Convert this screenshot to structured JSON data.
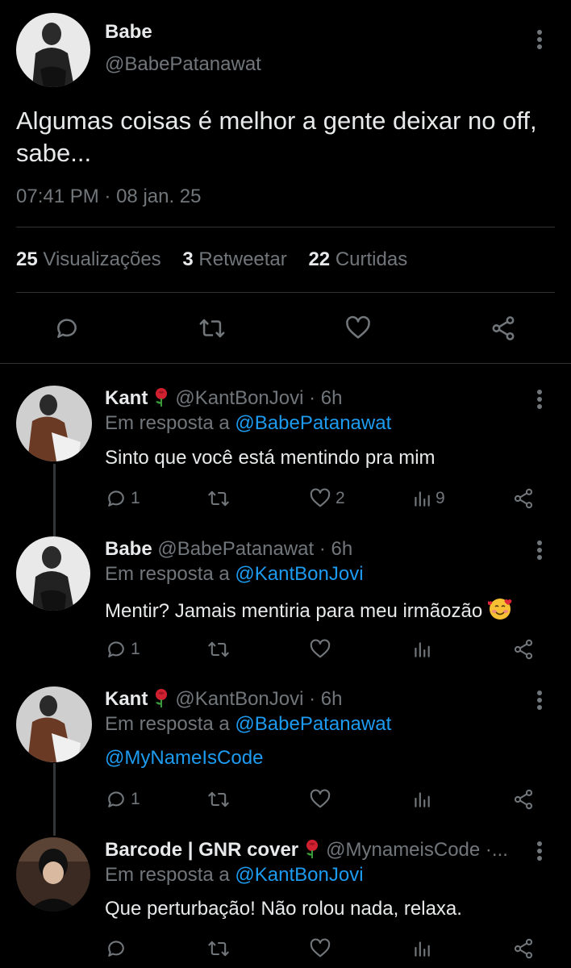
{
  "main_tweet": {
    "author_name": "Babe",
    "author_handle": "@BabePatanawat",
    "text": "Algumas coisas é melhor a gente deixar no off, sabe...",
    "time": "07:41 PM",
    "separator": "·",
    "date": "08 jan. 25",
    "stats": {
      "views_count": "25",
      "views_label": "Visualizações",
      "retweets_count": "3",
      "retweets_label": "Retweetar",
      "likes_count": "22",
      "likes_label": "Curtidas"
    },
    "actions": [
      "reply-icon",
      "retweet-icon",
      "like-icon",
      "share-icon"
    ]
  },
  "replies": [
    {
      "name": "Kant",
      "badge": "rose-emoji",
      "handle": "@KantBonJovi",
      "time": "· 6h",
      "reply_prefix": "Em resposta a",
      "reply_to": "@BabePatanawat",
      "text": "Sinto que você está mentindo pra mim",
      "reply_count": "1",
      "retweet_count": "",
      "like_count": "2",
      "view_count": "9"
    },
    {
      "name": "Babe",
      "badge": "",
      "handle": "@BabePatanawat",
      "time": "· 6h",
      "reply_prefix": "Em resposta a",
      "reply_to": "@KantBonJovi",
      "text": "Mentir? Jamais mentiria para meu irmãozão",
      "text_emoji": "smiling-face-with-hearts-emoji",
      "reply_count": "1",
      "retweet_count": "",
      "like_count": "",
      "view_count": ""
    },
    {
      "name": "Kant",
      "badge": "rose-emoji",
      "handle": "@KantBonJovi",
      "time": "· 6h",
      "reply_prefix": "Em resposta a",
      "reply_to": "@BabePatanawat",
      "text": "@MyNameIsCode",
      "reply_count": "1",
      "retweet_count": "",
      "like_count": "",
      "view_count": ""
    },
    {
      "name": "Barcode | GNR cover",
      "badge": "rose-emoji",
      "handle": "@MynameisCode",
      "time": "·...",
      "reply_prefix": "Em resposta a",
      "reply_to": "@KantBonJovi",
      "text": "Que perturbação! Não rolou nada, relaxa.",
      "reply_count": "",
      "retweet_count": "",
      "like_count": "",
      "view_count": ""
    }
  ],
  "colors": {
    "background": "#000000",
    "text_primary": "#e7e9ea",
    "text_secondary": "#71767b",
    "link": "#1d9bf0",
    "divider": "#2f3336"
  }
}
